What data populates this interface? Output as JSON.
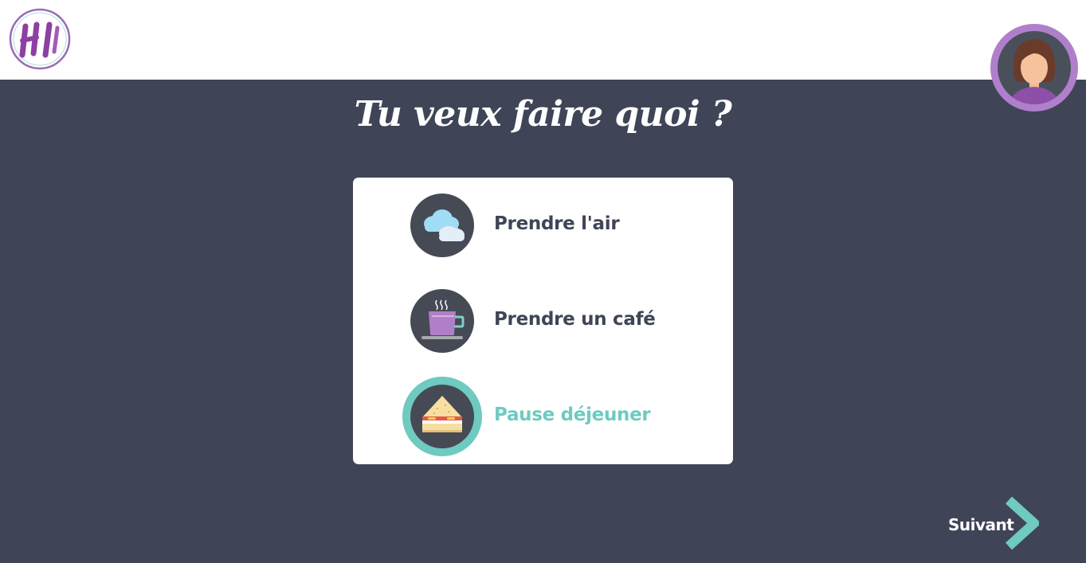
{
  "header": {
    "logo_text": "HI",
    "avatar_alt": "user-avatar"
  },
  "page": {
    "title": "Tu veux faire quoi ?"
  },
  "options": [
    {
      "label": "Prendre l'air",
      "icon": "clouds-icon",
      "selected": false
    },
    {
      "label": "Prendre un café",
      "icon": "coffee-cup-icon",
      "selected": false
    },
    {
      "label": "Pause déjeuner",
      "icon": "sandwich-icon",
      "selected": true
    }
  ],
  "footer": {
    "next_label": "Suivant"
  },
  "colors": {
    "background": "#3f4557",
    "accent": "#6fcac0",
    "brand": "#8e3fa3",
    "avatar_ring": "#b07fcb"
  }
}
